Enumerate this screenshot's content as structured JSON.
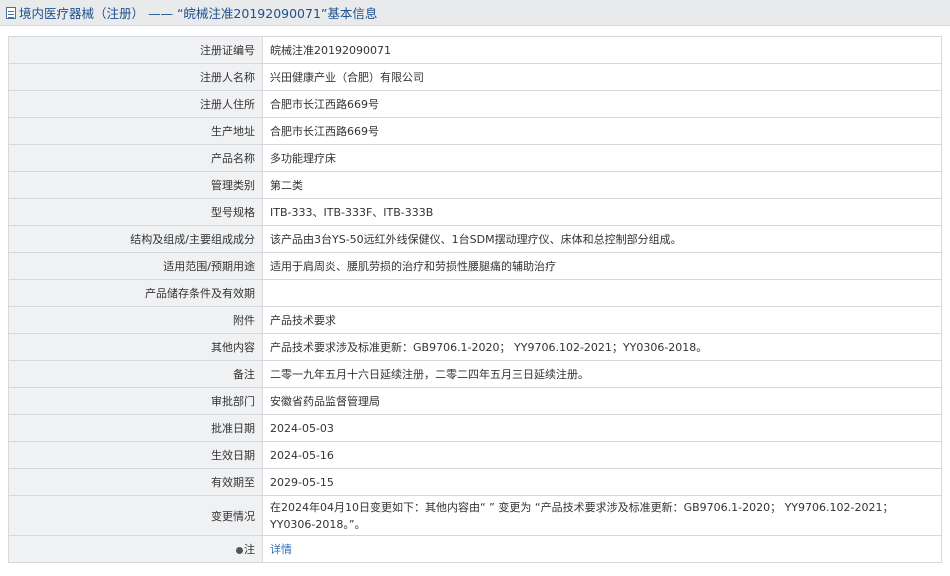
{
  "header": {
    "title": "境内医疗器械（注册） —— “皖械注准20192090071”基本信息"
  },
  "rows": [
    {
      "label": "注册证编号",
      "value": "皖械注准20192090071"
    },
    {
      "label": "注册人名称",
      "value": "兴田健康产业（合肥）有限公司"
    },
    {
      "label": "注册人住所",
      "value": "合肥市长江西路669号"
    },
    {
      "label": "生产地址",
      "value": "合肥市长江西路669号"
    },
    {
      "label": "产品名称",
      "value": "多功能理疗床"
    },
    {
      "label": "管理类别",
      "value": "第二类"
    },
    {
      "label": "型号规格",
      "value": "ITB-333、ITB-333F、ITB-333B"
    },
    {
      "label": "结构及组成/主要组成成分",
      "value": "该产品由3台YS-50远红外线保健仪、1台SDM摆动理疗仪、床体和总控制部分组成。"
    },
    {
      "label": "适用范围/预期用途",
      "value": "适用于肩周炎、腰肌劳损的治疗和劳损性腰腿痛的辅助治疗"
    },
    {
      "label": "产品储存条件及有效期",
      "value": ""
    },
    {
      "label": "附件",
      "value": "产品技术要求"
    },
    {
      "label": "其他内容",
      "value": "产品技术要求涉及标准更新：GB9706.1-2020； YY9706.102-2021；YY0306-2018。"
    },
    {
      "label": "备注",
      "value": "二零一九年五月十六日延续注册，二零二四年五月三日延续注册。"
    },
    {
      "label": "审批部门",
      "value": "安徽省药品监督管理局"
    },
    {
      "label": "批准日期",
      "value": "2024-05-03"
    },
    {
      "label": "生效日期",
      "value": "2024-05-16"
    },
    {
      "label": "有效期至",
      "value": "2029-05-15"
    },
    {
      "label": "变更情况",
      "value": "在2024年04月10日变更如下：其他内容由“ ” 变更为 “产品技术要求涉及标准更新：GB9706.1-2020； YY9706.102-2021；YY0306-2018。”。"
    }
  ],
  "note": {
    "label": "注",
    "link_text": "详情",
    "icon": "bullet-dot-icon"
  }
}
